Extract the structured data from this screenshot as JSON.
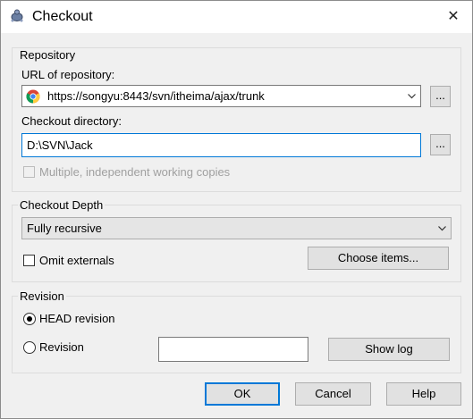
{
  "window": {
    "title": "Checkout",
    "close_glyph": "✕",
    "icon": "svn-turtle-icon"
  },
  "repository": {
    "group_label": "Repository",
    "url_label": "URL of repository:",
    "url_value": "https://songyu:8443/svn/itheima/ajax/trunk",
    "url_browse": "...",
    "dir_label": "Checkout directory:",
    "dir_value": "D:\\SVN\\Jack",
    "dir_browse": "...",
    "multiple_label": "Multiple, independent working copies",
    "multiple_checked": false
  },
  "depth": {
    "group_label": "Checkout Depth",
    "selected": "Fully recursive",
    "omit_externals_label": "Omit externals",
    "omit_externals_checked": false,
    "choose_items": "Choose items..."
  },
  "revision": {
    "group_label": "Revision",
    "head_label": "HEAD revision",
    "revision_label": "Revision",
    "revision_value": "",
    "show_log": "Show log",
    "selected": "head"
  },
  "buttons": {
    "ok": "OK",
    "cancel": "Cancel",
    "help": "Help"
  }
}
